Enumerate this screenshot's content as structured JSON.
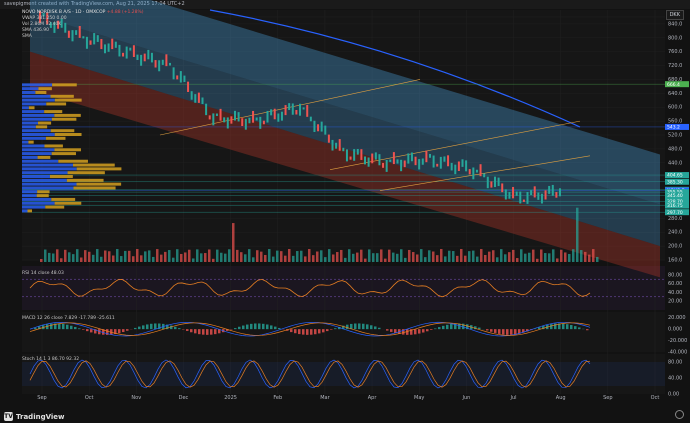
{
  "header": {
    "caption": "savepigment created with TradingView.com, Aug 21, 2025 17:04 UTC+2"
  },
  "legend": {
    "symbol": "NOVO NORDISK B A/S · 1D · OMXCOP",
    "change": "+4.88 (+1.28%)",
    "line2": "VWAP 381.250 0.00",
    "line3": "Vol 2.86M 12.40K",
    "line4": "SMA 436.90",
    "line5": "SMA"
  },
  "currency": "DKK",
  "price_axis": {
    "ticks": [
      "860.0",
      "840.0",
      "800.0",
      "760.0",
      "720.0",
      "680.0",
      "640.0",
      "600.0",
      "560.0",
      "520.0",
      "480.0",
      "440.0",
      "400.0",
      "360.0",
      "320.0",
      "280.0",
      "240.0",
      "200.0",
      "160.0"
    ],
    "tags": [
      {
        "text": "666.4",
        "color": "#4caf50"
      },
      {
        "text": "543.2",
        "color": "#2962ff"
      },
      {
        "text": "404.65",
        "color": "#26a69a"
      },
      {
        "text": "385.30",
        "color": "#26a69a"
      },
      {
        "text": "362.20",
        "color": "#26a69a"
      },
      {
        "text": "NOVO B",
        "color": "#2962ff"
      },
      {
        "text": "355.55",
        "color": "#26a69a"
      },
      {
        "text": "345.40",
        "color": "#26a69a"
      },
      {
        "text": "328.70",
        "color": "#26a69a"
      },
      {
        "text": "316.75",
        "color": "#26a69a"
      },
      {
        "text": "297.70",
        "color": "#26a69a"
      }
    ]
  },
  "rsi": {
    "label": "RSI 14 close 48.03",
    "ticks": [
      "80.00",
      "60.00",
      "40.00",
      "20.00"
    ]
  },
  "macd": {
    "label": "MACD 12 26 close 7.829 -17.789 -25.611",
    "ticks": [
      "20.000",
      "0.000",
      "-20.000",
      "-40.000"
    ]
  },
  "stoch": {
    "label": "Stoch 14 1 3 86.70 92.32",
    "ticks": [
      "80.00",
      "40.00",
      "0.00"
    ]
  },
  "time_axis": [
    "Sep",
    "Oct",
    "Nov",
    "Dec",
    "2025",
    "Feb",
    "Mar",
    "Apr",
    "May",
    "Jun",
    "Jul",
    "Aug",
    "Sep",
    "Oct"
  ],
  "footer": {
    "brand": "TradingView"
  },
  "chart_data": {
    "type": "line",
    "title": "NOVO NORDISK B A/S · 1D · OMXCOP",
    "xlabel": "",
    "ylabel": "",
    "ylim": [
      160,
      880
    ],
    "x": [
      "Sep",
      "Oct",
      "Nov",
      "Dec",
      "2025",
      "Feb",
      "Mar",
      "Apr",
      "May",
      "Jun",
      "Jul",
      "Aug",
      "Sep"
    ],
    "series": [
      {
        "values": [
          860,
          800,
          760,
          720,
          570,
          560,
          600,
          470,
          440,
          450,
          420,
          340,
          355
        ]
      }
    ],
    "grid": true
  }
}
